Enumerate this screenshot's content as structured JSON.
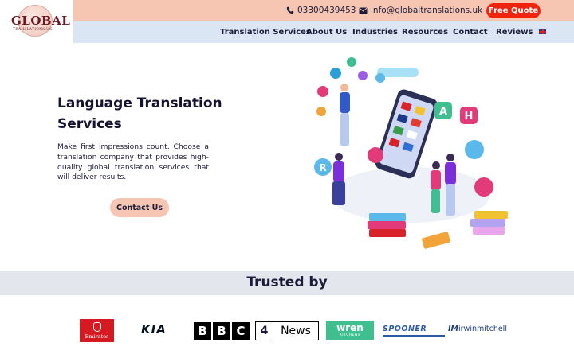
{
  "header": {
    "logo": {
      "name": "GLOBAL",
      "sub": "TRANSLATIONS.UK"
    },
    "phone": "03300439453",
    "email": "info@globaltranslations.uk",
    "quote_label": "Free Quote",
    "nav": [
      "Translation Services",
      "About Us",
      "Industries",
      "Resources",
      "Contact",
      "Reviews"
    ],
    "flag_icon": "uk-flag-icon"
  },
  "hero": {
    "title_line1": "Language Translation",
    "title_line2": "Services",
    "text": "Make first impressions count. Choose a translation company that provides high-quality global translation services that will deliver results.",
    "button": "Contact Us"
  },
  "trusted": {
    "title": "Trusted by",
    "logos": {
      "emirates": "Emirates",
      "kia": "KIA",
      "bbc": [
        "B",
        "B",
        "C"
      ],
      "channel4": "4",
      "news": "News",
      "wren": "wren",
      "wren_sub": "KITCHENS",
      "spooner": "SPOONER",
      "irwin_prefix": "IM",
      "irwin": "irwinmitchell"
    }
  },
  "colors": {
    "topbar": "#f6c6b2",
    "navbar": "#dbe6f5",
    "accent": "#f0230f",
    "trusted_band": "#e3e6ec"
  }
}
